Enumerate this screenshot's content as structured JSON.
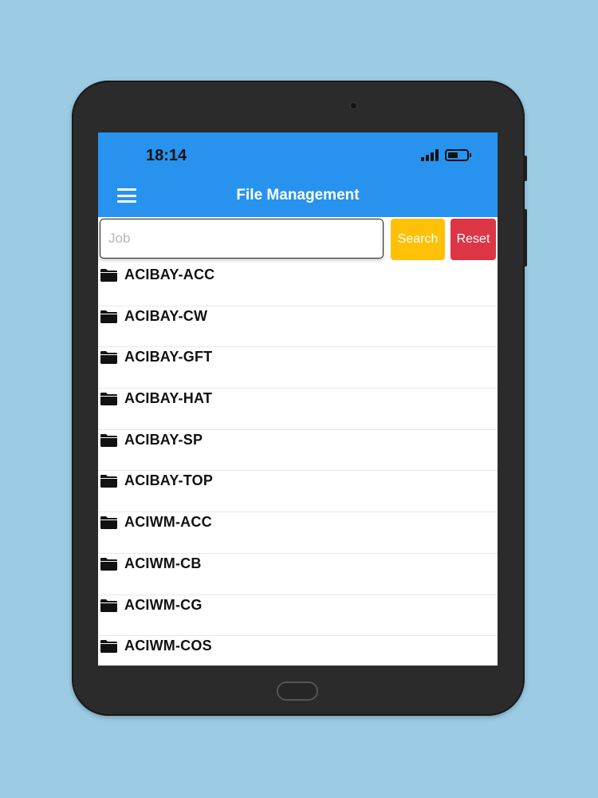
{
  "status_bar": {
    "time": "18:14"
  },
  "app_bar": {
    "title": "File Management",
    "menu_icon": "hamburger-menu-icon",
    "color": "#2793ee"
  },
  "search": {
    "placeholder": "Job",
    "value": "",
    "search_label": "Search",
    "reset_label": "Reset",
    "search_color": "#ffc107",
    "reset_color": "#dc3545"
  },
  "folders": {
    "icon": "folder-icon",
    "items": [
      {
        "label": "ACIBAY-ACC"
      },
      {
        "label": "ACIBAY-CW"
      },
      {
        "label": "ACIBAY-GFT"
      },
      {
        "label": "ACIBAY-HAT"
      },
      {
        "label": "ACIBAY-SP"
      },
      {
        "label": "ACIBAY-TOP"
      },
      {
        "label": "ACIWM-ACC"
      },
      {
        "label": "ACIWM-CB"
      },
      {
        "label": "ACIWM-CG"
      },
      {
        "label": "ACIWM-COS"
      }
    ]
  }
}
